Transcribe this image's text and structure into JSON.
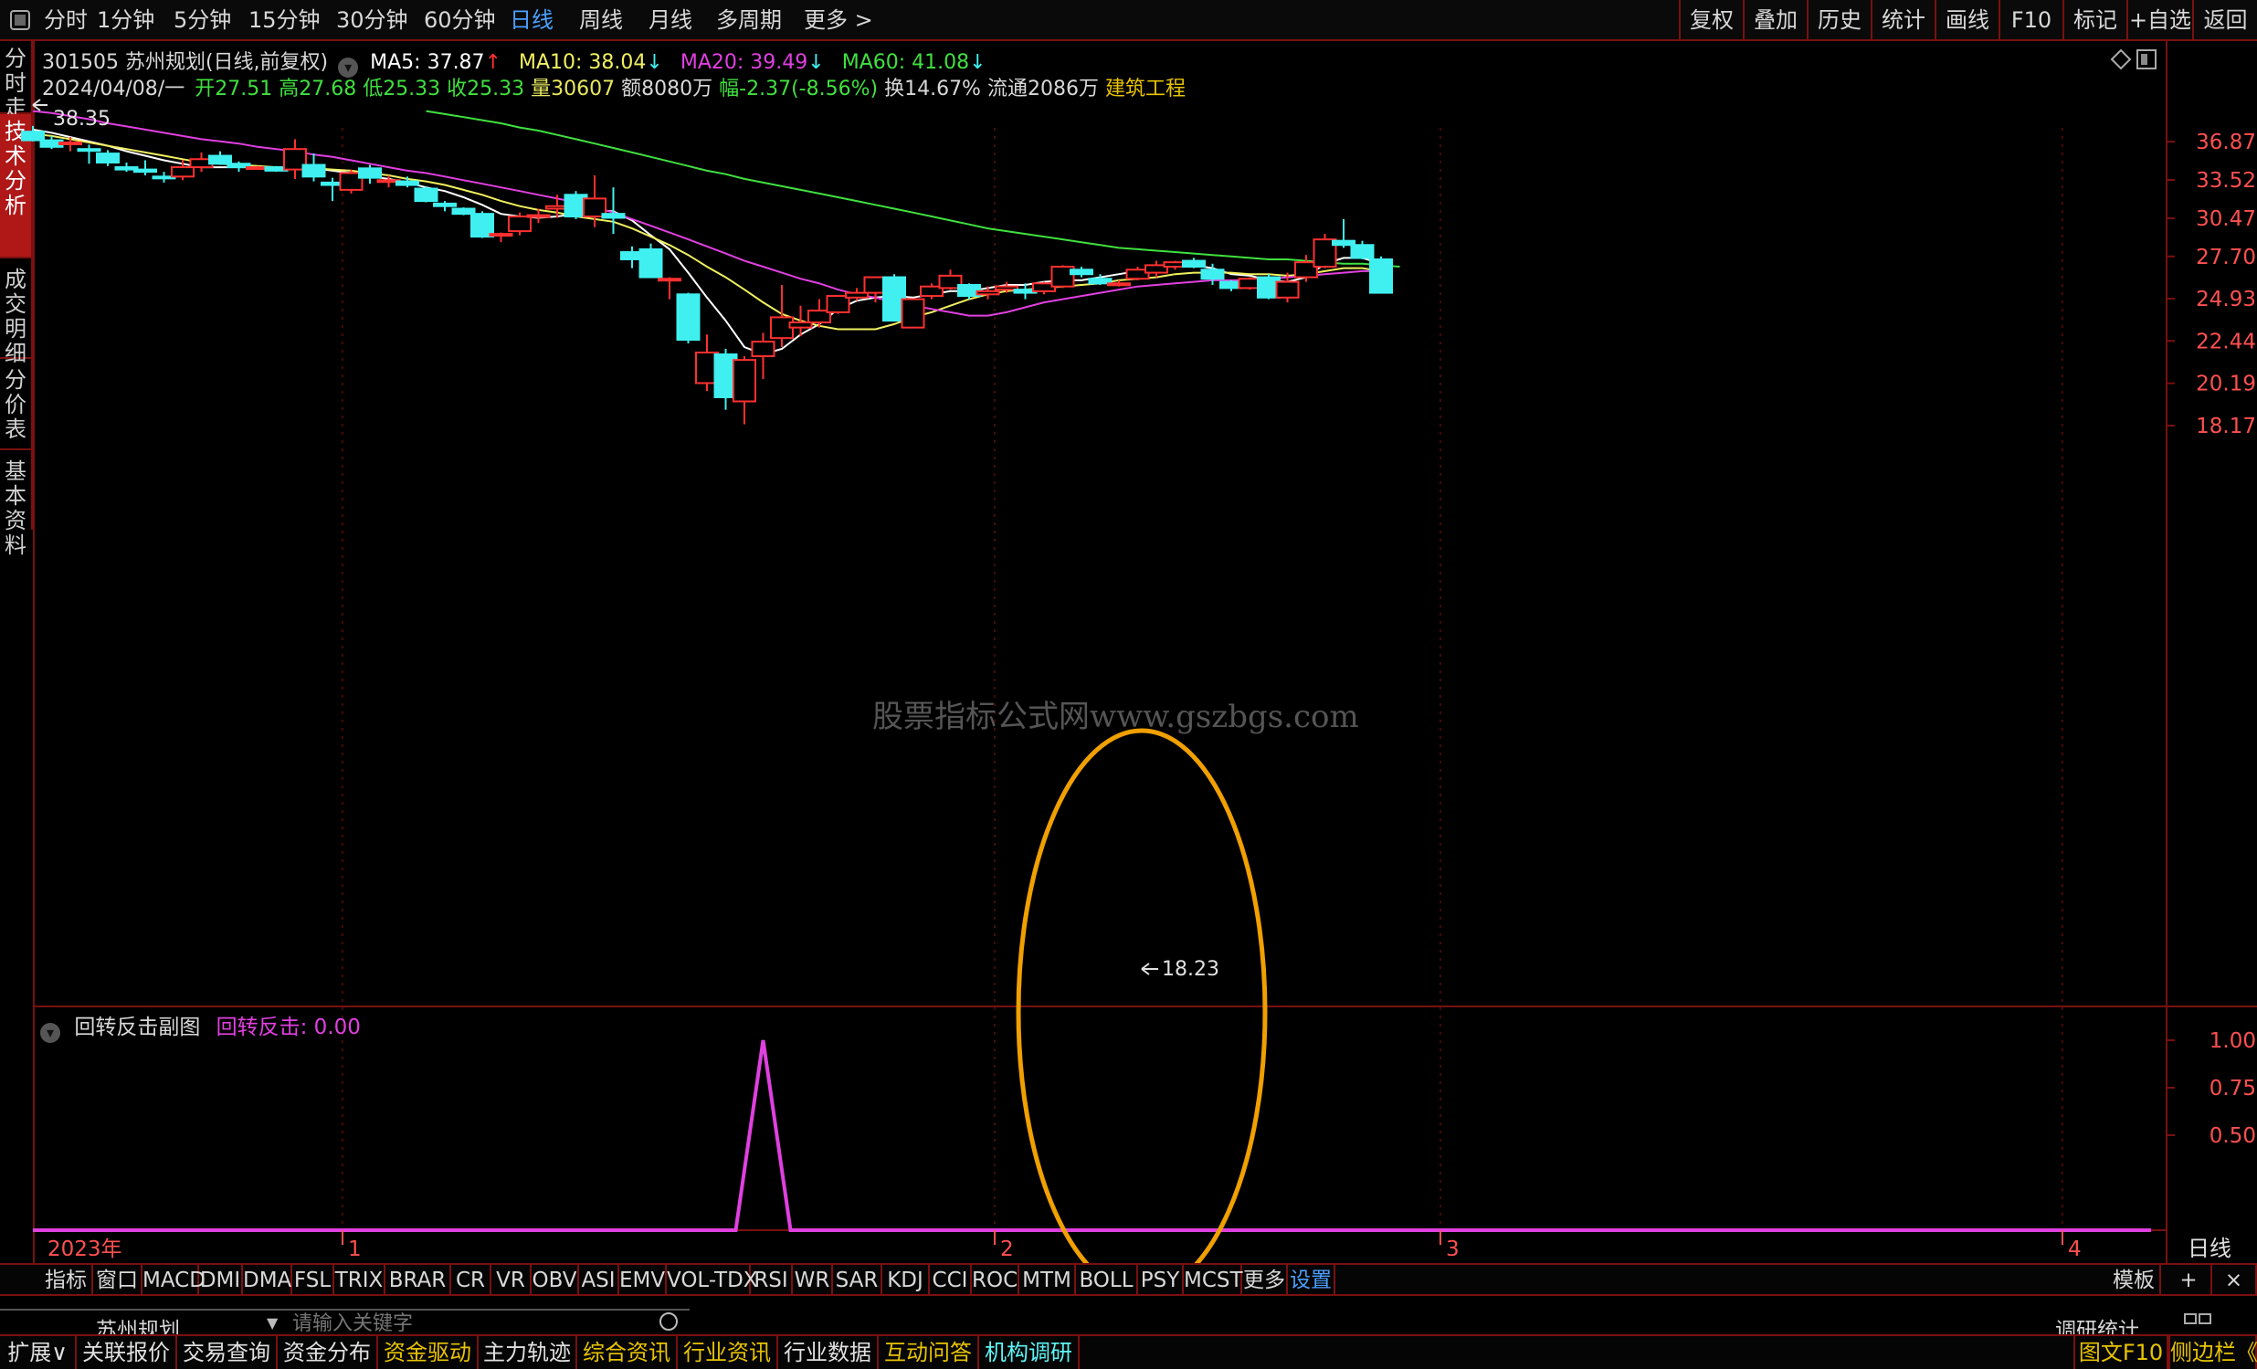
{
  "topbar": {
    "tabs": [
      "分时",
      "1分钟",
      "5分钟",
      "15分钟",
      "30分钟",
      "60分钟",
      "日线",
      "周线",
      "月线",
      "多周期",
      "更多 >"
    ],
    "active_tab": "日线",
    "right_buttons": [
      "复权",
      "叠加",
      "历史",
      "统计",
      "画线",
      "F10",
      "标记",
      "+自选",
      "返回"
    ]
  },
  "sidebar": {
    "tabs": [
      "分时走势",
      "技术分析",
      "成交明细",
      "分价表",
      "基本资料"
    ],
    "active": "技术分析"
  },
  "stock": {
    "code_name": "301505 苏州规划(日线,前复权)",
    "ma5_label": "MA5: 37.87",
    "ma10_label": "MA10: 38.04",
    "ma20_label": "MA20: 39.49",
    "ma60_label": "MA60: 41.08",
    "date": "2024/04/08/一",
    "open": "开27.51",
    "high": "高27.68",
    "low": "低25.33",
    "close": "收25.33",
    "volume": "量30607",
    "amount": "额8080万",
    "change": "幅-2.37(-8.56%)",
    "turnover": "换14.67%",
    "float": "流通2086万",
    "industry": "建筑工程"
  },
  "chart_data": {
    "type": "candlestick",
    "y_ticks": [
      "36.87",
      "33.52",
      "30.47",
      "27.70",
      "24.93",
      "22.44",
      "20.19",
      "18.17"
    ],
    "high_marker": "38.35",
    "low_marker": "18.23",
    "x_labels": [
      "2023年",
      "1",
      "2",
      "3",
      "4"
    ],
    "period_label": "日线",
    "watermark": "股票指标公式网www.gszbgs.com",
    "series": [
      {
        "name": "MA5",
        "color": "#ffffff"
      },
      {
        "name": "MA10",
        "color": "#f0f060"
      },
      {
        "name": "MA20",
        "color": "#e040e0"
      },
      {
        "name": "MA60",
        "color": "#40e040"
      }
    ],
    "candles": [
      {
        "o": 37.8,
        "h": 38.35,
        "l": 36.9,
        "c": 37.0
      },
      {
        "o": 37.0,
        "h": 37.4,
        "l": 36.2,
        "c": 36.4
      },
      {
        "o": 36.7,
        "h": 37.3,
        "l": 36.0,
        "c": 36.8
      },
      {
        "o": 36.2,
        "h": 36.6,
        "l": 34.9,
        "c": 36.1
      },
      {
        "o": 35.8,
        "h": 36.1,
        "l": 34.7,
        "c": 35.0
      },
      {
        "o": 34.6,
        "h": 35.0,
        "l": 34.2,
        "c": 34.4
      },
      {
        "o": 34.4,
        "h": 35.2,
        "l": 33.9,
        "c": 34.2
      },
      {
        "o": 33.8,
        "h": 34.2,
        "l": 33.3,
        "c": 33.7
      },
      {
        "o": 33.8,
        "h": 35.2,
        "l": 33.5,
        "c": 34.6
      },
      {
        "o": 34.6,
        "h": 35.9,
        "l": 34.2,
        "c": 35.3
      },
      {
        "o": 35.6,
        "h": 36.0,
        "l": 34.8,
        "c": 34.9
      },
      {
        "o": 34.9,
        "h": 35.1,
        "l": 34.2,
        "c": 34.6
      },
      {
        "o": 34.5,
        "h": 34.7,
        "l": 34.4,
        "c": 34.6
      },
      {
        "o": 34.6,
        "h": 34.7,
        "l": 34.2,
        "c": 34.3
      },
      {
        "o": 34.4,
        "h": 37.1,
        "l": 33.6,
        "c": 36.2
      },
      {
        "o": 34.8,
        "h": 35.8,
        "l": 33.4,
        "c": 33.8
      },
      {
        "o": 33.3,
        "h": 33.7,
        "l": 31.8,
        "c": 33.1
      },
      {
        "o": 32.7,
        "h": 34.4,
        "l": 32.4,
        "c": 34.1
      },
      {
        "o": 34.5,
        "h": 34.8,
        "l": 33.2,
        "c": 33.7
      },
      {
        "o": 33.4,
        "h": 33.9,
        "l": 32.9,
        "c": 33.5
      },
      {
        "o": 33.4,
        "h": 33.8,
        "l": 32.9,
        "c": 33.1
      },
      {
        "o": 32.8,
        "h": 33.0,
        "l": 31.7,
        "c": 31.8
      },
      {
        "o": 31.6,
        "h": 31.8,
        "l": 31.0,
        "c": 31.4
      },
      {
        "o": 31.2,
        "h": 31.3,
        "l": 30.7,
        "c": 30.8
      },
      {
        "o": 30.8,
        "h": 31.0,
        "l": 29.0,
        "c": 29.1
      },
      {
        "o": 29.2,
        "h": 29.4,
        "l": 28.7,
        "c": 29.3
      },
      {
        "o": 29.5,
        "h": 30.9,
        "l": 29.2,
        "c": 30.6
      },
      {
        "o": 30.6,
        "h": 31.2,
        "l": 30.1,
        "c": 30.7
      },
      {
        "o": 31.2,
        "h": 32.3,
        "l": 30.5,
        "c": 31.4
      },
      {
        "o": 32.3,
        "h": 32.6,
        "l": 30.4,
        "c": 30.6
      },
      {
        "o": 30.6,
        "h": 33.9,
        "l": 29.8,
        "c": 32.0
      },
      {
        "o": 30.8,
        "h": 32.9,
        "l": 29.3,
        "c": 30.5
      },
      {
        "o": 28.0,
        "h": 28.4,
        "l": 26.9,
        "c": 27.5
      },
      {
        "o": 28.2,
        "h": 28.6,
        "l": 27.1,
        "c": 26.3
      },
      {
        "o": 26.1,
        "h": 26.3,
        "l": 24.9,
        "c": 26.2
      },
      {
        "o": 25.2,
        "h": 25.3,
        "l": 22.3,
        "c": 22.5
      },
      {
        "o": 20.2,
        "h": 22.8,
        "l": 19.8,
        "c": 21.8
      },
      {
        "o": 21.7,
        "h": 22.0,
        "l": 18.9,
        "c": 19.5
      },
      {
        "o": 19.3,
        "h": 21.6,
        "l": 18.23,
        "c": 21.4
      },
      {
        "o": 21.6,
        "h": 22.9,
        "l": 20.4,
        "c": 22.4
      },
      {
        "o": 22.6,
        "h": 25.8,
        "l": 22.1,
        "c": 23.8
      },
      {
        "o": 23.2,
        "h": 24.5,
        "l": 22.7,
        "c": 23.5
      },
      {
        "o": 23.5,
        "h": 24.9,
        "l": 23.2,
        "c": 24.2
      },
      {
        "o": 24.1,
        "h": 25.1,
        "l": 24.0,
        "c": 25.1
      },
      {
        "o": 25.0,
        "h": 25.6,
        "l": 24.8,
        "c": 25.3
      },
      {
        "o": 25.3,
        "h": 26.1,
        "l": 24.7,
        "c": 26.3
      },
      {
        "o": 26.3,
        "h": 26.5,
        "l": 23.7,
        "c": 23.6
      },
      {
        "o": 23.2,
        "h": 24.9,
        "l": 23.2,
        "c": 24.9
      },
      {
        "o": 25.1,
        "h": 25.9,
        "l": 24.9,
        "c": 25.7
      },
      {
        "o": 25.6,
        "h": 26.8,
        "l": 25.5,
        "c": 26.4
      },
      {
        "o": 25.8,
        "h": 25.9,
        "l": 24.9,
        "c": 25.1
      },
      {
        "o": 25.2,
        "h": 25.7,
        "l": 24.9,
        "c": 25.4
      },
      {
        "o": 25.5,
        "h": 26.0,
        "l": 25.3,
        "c": 25.7
      },
      {
        "o": 25.5,
        "h": 25.9,
        "l": 24.9,
        "c": 25.3
      },
      {
        "o": 25.4,
        "h": 26.0,
        "l": 25.2,
        "c": 25.9
      },
      {
        "o": 25.7,
        "h": 27.1,
        "l": 25.6,
        "c": 27.0
      },
      {
        "o": 26.8,
        "h": 27.0,
        "l": 26.3,
        "c": 26.5
      },
      {
        "o": 26.2,
        "h": 26.5,
        "l": 25.8,
        "c": 25.9
      },
      {
        "o": 25.8,
        "h": 26.1,
        "l": 25.7,
        "c": 25.9
      },
      {
        "o": 26.2,
        "h": 27.0,
        "l": 26.1,
        "c": 26.8
      },
      {
        "o": 26.6,
        "h": 27.4,
        "l": 26.3,
        "c": 27.1
      },
      {
        "o": 27.0,
        "h": 27.4,
        "l": 26.8,
        "c": 27.3
      },
      {
        "o": 27.4,
        "h": 27.6,
        "l": 26.9,
        "c": 27.0
      },
      {
        "o": 26.8,
        "h": 27.2,
        "l": 25.8,
        "c": 26.2
      },
      {
        "o": 26.0,
        "h": 26.1,
        "l": 25.4,
        "c": 25.6
      },
      {
        "o": 25.6,
        "h": 26.3,
        "l": 25.5,
        "c": 26.2
      },
      {
        "o": 26.3,
        "h": 26.5,
        "l": 24.9,
        "c": 25.0
      },
      {
        "o": 25.0,
        "h": 26.6,
        "l": 24.7,
        "c": 26.0
      },
      {
        "o": 26.3,
        "h": 27.8,
        "l": 26.0,
        "c": 27.3
      },
      {
        "o": 27.0,
        "h": 29.3,
        "l": 26.9,
        "c": 28.9
      },
      {
        "o": 28.8,
        "h": 30.4,
        "l": 28.3,
        "c": 28.5
      },
      {
        "o": 28.5,
        "h": 28.8,
        "l": 27.5,
        "c": 27.6
      },
      {
        "o": 27.5,
        "h": 27.7,
        "l": 25.3,
        "c": 25.3
      }
    ],
    "ma_series": {
      "MA5": {
        "start": 0,
        "values": [
          38.0,
          37.7,
          37.3,
          36.9,
          36.5,
          36.0,
          35.6,
          35.2,
          34.9,
          34.6,
          34.6,
          34.6,
          34.6,
          34.6,
          34.6,
          34.5,
          34.3,
          34.1,
          33.8,
          33.6,
          33.3,
          32.9,
          32.6,
          32.1,
          31.5,
          30.8,
          30.6,
          30.5,
          30.6,
          30.8,
          31.1,
          31.0,
          30.3,
          29.2,
          28.2,
          26.6,
          25.0,
          23.6,
          22.1,
          21.7,
          22.0,
          22.8,
          23.4,
          24.3,
          24.8,
          25.0,
          25.1,
          25.0,
          25.2,
          25.4,
          25.4,
          25.6,
          25.8,
          25.8,
          26.0,
          26.1,
          26.1,
          26.3,
          26.5,
          26.7,
          26.9,
          27.1,
          27.1,
          26.9,
          26.5,
          26.4,
          26.1,
          26.0,
          26.3,
          27.2,
          27.6,
          27.6,
          27.2
        ]
      },
      "MA10": {
        "start": 0,
        "values": [
          37.6,
          37.4,
          37.1,
          36.8,
          36.5,
          36.2,
          35.9,
          35.6,
          35.3,
          35.0,
          34.9,
          34.8,
          34.7,
          34.6,
          34.6,
          34.5,
          34.4,
          34.3,
          34.1,
          33.9,
          33.6,
          33.4,
          33.1,
          32.7,
          32.3,
          31.8,
          31.4,
          31.1,
          30.9,
          30.6,
          30.4,
          30.2,
          29.7,
          29.1,
          28.5,
          27.8,
          27.0,
          26.3,
          25.5,
          24.7,
          24.0,
          23.6,
          23.3,
          23.1,
          23.1,
          23.1,
          23.4,
          23.8,
          24.1,
          24.5,
          24.9,
          25.2,
          25.4,
          25.5,
          25.6,
          25.7,
          25.8,
          25.9,
          26.1,
          26.2,
          26.3,
          26.5,
          26.6,
          26.6,
          26.6,
          26.5,
          26.5,
          26.4,
          26.5,
          26.7,
          26.9,
          26.9,
          26.7
        ]
      },
      "MA20": {
        "start": 0,
        "values": [
          39.8,
          39.6,
          39.3,
          39.0,
          38.6,
          38.3,
          38.0,
          37.7,
          37.4,
          37.1,
          36.9,
          36.7,
          36.4,
          36.2,
          36.0,
          35.7,
          35.5,
          35.2,
          34.9,
          34.6,
          34.3,
          34.1,
          33.8,
          33.5,
          33.2,
          32.9,
          32.6,
          32.3,
          32.0,
          31.7,
          31.3,
          30.9,
          30.4,
          29.9,
          29.4,
          28.9,
          28.4,
          27.9,
          27.4,
          27.0,
          26.6,
          26.2,
          25.9,
          25.5,
          25.2,
          25.0,
          24.7,
          24.5,
          24.3,
          24.1,
          23.9,
          23.9,
          24.1,
          24.4,
          24.7,
          24.9,
          25.1,
          25.3,
          25.5,
          25.7,
          25.8,
          25.9,
          26.0,
          26.1,
          26.1,
          26.1,
          26.2,
          26.3,
          26.4,
          26.5,
          26.6,
          26.7,
          26.7
        ]
      },
      "MA60": {
        "start": 21,
        "values": [
          39.8,
          39.5,
          39.2,
          38.9,
          38.6,
          38.2,
          37.9,
          37.5,
          37.1,
          36.7,
          36.3,
          35.9,
          35.5,
          35.1,
          34.7,
          34.3,
          34.0,
          33.6,
          33.3,
          33.0,
          32.7,
          32.4,
          32.1,
          31.8,
          31.5,
          31.2,
          30.9,
          30.6,
          30.3,
          30.0,
          29.7,
          29.5,
          29.3,
          29.1,
          28.9,
          28.7,
          28.5,
          28.3,
          28.2,
          28.1,
          28.0,
          27.9,
          27.8,
          27.7,
          27.6,
          27.5,
          27.5,
          27.4,
          27.3,
          27.2,
          27.2,
          27.1,
          27.0
        ]
      }
    }
  },
  "subchart": {
    "title": "回转反击副图",
    "label": "回转反击: 0.00",
    "y_ticks": [
      "1.00",
      "0.75",
      "0.50"
    ],
    "indicator": {
      "name": "回转反击",
      "peak_index": 39,
      "peak_value": 1.0
    }
  },
  "indicator_tabs": [
    "指标",
    "窗口",
    "MACD",
    "DMI",
    "DMA",
    "FSL",
    "TRIX",
    "BRAR",
    "CR",
    "VR",
    "OBV",
    "ASI",
    "EMV",
    "VOL-TDX",
    "RSI",
    "WR",
    "SAR",
    "KDJ",
    "CCI",
    "ROC",
    "MTM",
    "BOLL",
    "PSY",
    "MCST",
    "更多",
    "设置"
  ],
  "indicator_right": [
    "模板",
    "+",
    "×"
  ],
  "search": {
    "name": "苏州规划",
    "placeholder": "请输入关键字",
    "right_label": "调研统计"
  },
  "footer": {
    "tabs": [
      "扩展∨",
      "关联报价",
      "交易查询",
      "资金分布",
      "资金驱动",
      "主力轨迹",
      "综合资讯",
      "行业资讯",
      "行业数据",
      "互动问答",
      "机构调研"
    ],
    "right": [
      "图文F10",
      "侧边栏《"
    ]
  },
  "colors": {
    "up": "#ff3030",
    "down": "#40f0f0",
    "frame": "#7a1010",
    "accent": "#4aa0ff",
    "magenta": "#e040e0",
    "annotation": "#f0a000"
  }
}
